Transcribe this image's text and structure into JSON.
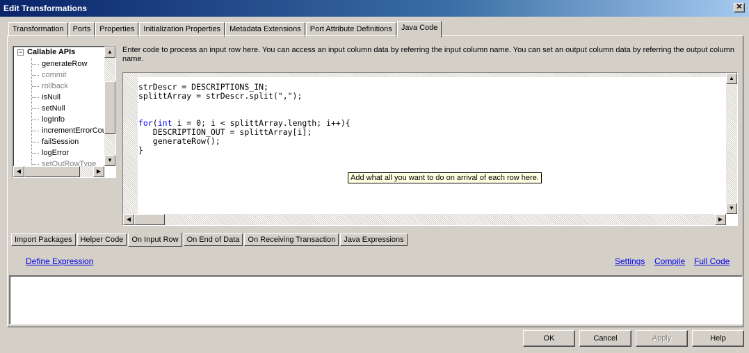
{
  "window": {
    "title": "Edit Transformations",
    "close_glyph": "✕"
  },
  "tabs": [
    {
      "label": "Transformation"
    },
    {
      "label": "Ports"
    },
    {
      "label": "Properties"
    },
    {
      "label": "Initialization Properties"
    },
    {
      "label": "Metadata Extensions"
    },
    {
      "label": "Port Attribute Definitions"
    },
    {
      "label": "Java Code",
      "active": true
    }
  ],
  "api_tree": {
    "root_label": "Callable APIs",
    "expand_glyph": "−",
    "items": [
      {
        "label": "generateRow",
        "enabled": true
      },
      {
        "label": "commit",
        "enabled": false
      },
      {
        "label": "rollback",
        "enabled": false
      },
      {
        "label": "isNull",
        "enabled": true
      },
      {
        "label": "setNull",
        "enabled": true
      },
      {
        "label": "logInfo",
        "enabled": true
      },
      {
        "label": "incrementErrorCount",
        "enabled": true
      },
      {
        "label": "failSession",
        "enabled": true
      },
      {
        "label": "logError",
        "enabled": true
      },
      {
        "label": "setOutRowType",
        "enabled": false
      }
    ]
  },
  "editor": {
    "instruction": "Enter code to process an input row here. You can access an input column data by referring the input column name. You can set an output column data by referring the output column name.",
    "code_lines": [
      "strDescr = DESCRIPTIONS_IN;",
      "splittArray = strDescr.split(\",\");",
      "",
      "",
      "for(int i = 0; i < splittArray.length; i++){",
      "   DESCRIPTION_OUT = splittArray[i];",
      "   generateRow();",
      "}"
    ],
    "tooltip": "Add what all you want to do on arrival of each row here."
  },
  "subtabs": [
    {
      "label": "Import Packages"
    },
    {
      "label": "Helper Code"
    },
    {
      "label": "On Input Row",
      "active": true
    },
    {
      "label": "On End of Data"
    },
    {
      "label": "On Receiving Transaction"
    },
    {
      "label": "Java Expressions"
    }
  ],
  "links": {
    "define_expression": "Define Expression",
    "settings": "Settings",
    "compile": "Compile",
    "full_code": "Full Code"
  },
  "expression_box": {
    "value": ""
  },
  "buttons": {
    "ok": "OK",
    "cancel": "Cancel",
    "apply": "Apply",
    "help": "Help"
  },
  "icons": {
    "scroll_up": "▲",
    "scroll_down": "▼",
    "scroll_left": "◀",
    "scroll_right": "▶"
  }
}
